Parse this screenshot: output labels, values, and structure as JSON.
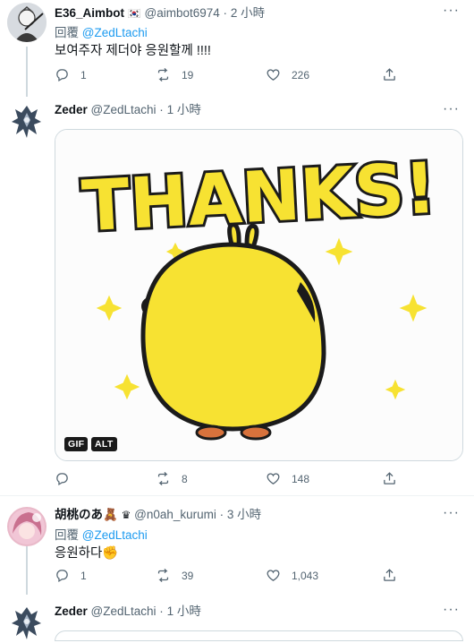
{
  "tweets": [
    {
      "name": "E36_Aimbot",
      "flag": "🇰🇷",
      "handle": "@aimbot6974",
      "dot": "·",
      "time": "2 小時",
      "reply_prefix": "回覆",
      "reply_mention": "@ZedLtachi",
      "text": "보여주자 제더야 응원할께 !!!!",
      "replies": "1",
      "retweets": "19",
      "likes": "226"
    },
    {
      "name": "Zeder",
      "handle": "@ZedLtachi",
      "dot": "·",
      "time": "1 小時",
      "media_text": "THANKS!",
      "badge_gif": "GIF",
      "badge_alt": "ALT",
      "replies": "",
      "retweets": "8",
      "likes": "148"
    },
    {
      "name": "胡桃のあ🧸",
      "crown": "♛",
      "handle": "@n0ah_kurumi",
      "dot": "·",
      "time": "3 小時",
      "reply_prefix": "回覆",
      "reply_mention": "@ZedLtachi",
      "text": "응원하다✊",
      "replies": "1",
      "retweets": "39",
      "likes": "1,043"
    },
    {
      "name": "Zeder",
      "handle": "@ZedLtachi",
      "dot": "·",
      "time": "1 小時"
    }
  ],
  "icons": {
    "more": "more-icon",
    "reply": "reply-icon",
    "retweet": "retweet-icon",
    "like": "heart-icon",
    "share": "share-icon"
  },
  "colors": {
    "link": "#1d9bf0",
    "secondary": "#536471",
    "chick": "#f7e232",
    "outline": "#1b1b1b"
  }
}
